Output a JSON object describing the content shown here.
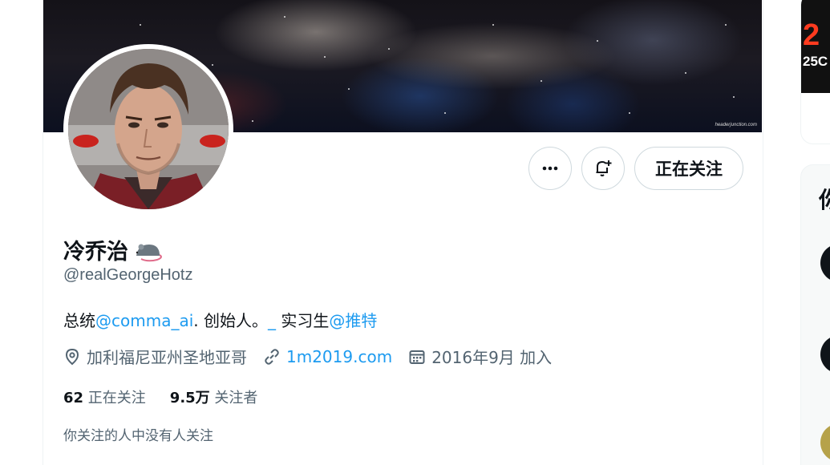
{
  "profile": {
    "display_name": "冷乔治",
    "name_emoji": "rat-emoji",
    "handle": "@realGeorgeHotz",
    "bio": {
      "prefix": "总统",
      "mention1": "@comma_ai",
      "middle": ". 创始人。",
      "underscore": "_",
      "middle2": " 实习生",
      "mention2": "@推特"
    },
    "location": "加利福尼亚州圣地亚哥",
    "website": "1m2019.com",
    "joined": "2016年9月 加入",
    "following_count": "62",
    "following_label": "正在关注",
    "followers_count": "9.5万",
    "followers_label": "关注者",
    "followed_by_note": "你关注的人中没有人关注"
  },
  "actions": {
    "more_icon": "more-dots-icon",
    "notify_icon": "bell-plus-icon",
    "follow_label": "正在关注"
  },
  "banner": {
    "watermark": "headerjunction.com"
  },
  "right_col": {
    "ad_number": "2",
    "ad_sub": "25C",
    "who_title": "你"
  },
  "colors": {
    "accent": "#1d9bf0",
    "secondary_text": "#536471",
    "primary_text": "#0f1419",
    "border": "#cfd9de"
  }
}
